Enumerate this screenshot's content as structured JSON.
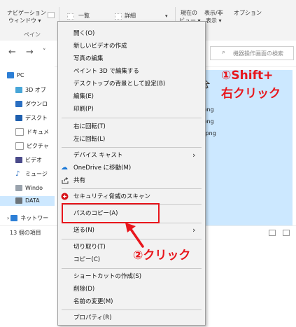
{
  "ribbon": {
    "nav_pane_label_1": "ナビゲーション",
    "nav_pane_label_2": "ウィンドウ ▾",
    "pane_group": "ペイン",
    "view_list": "一覧",
    "view_details": "詳細",
    "current_view_1": "現在の",
    "current_view_2": "ビュー ▾",
    "show_hide_1": "表示/非",
    "show_hide_2": "表示 ▾",
    "options": "オプション"
  },
  "search": {
    "placeholder": "機器操作画面の検索"
  },
  "nav_pane": {
    "items": [
      {
        "label": "PC"
      },
      {
        "label": "3D オブ"
      },
      {
        "label": "ダウンロ"
      },
      {
        "label": "デスクト"
      },
      {
        "label": "ドキュメ"
      },
      {
        "label": "ピクチャ"
      },
      {
        "label": "ビデオ"
      },
      {
        "label": "ミュージ"
      },
      {
        "label": "Windo"
      },
      {
        "label": "DATA"
      },
      {
        "label": "ネットワー"
      }
    ]
  },
  "files": [
    {
      "name": "e.png"
    },
    {
      "name": "e.png"
    },
    {
      "name": "te.png"
    }
  ],
  "status": {
    "item_count": "13 個の項目"
  },
  "context_menu": {
    "items": [
      {
        "label": "開く(O)"
      },
      {
        "label": "新しいビデオの作成"
      },
      {
        "label": "写真の編集"
      },
      {
        "label": "ペイント 3D で編集する"
      },
      {
        "label": "デスクトップの背景として設定(B)"
      },
      {
        "label": "編集(E)"
      },
      {
        "label": "印刷(P)"
      },
      {
        "label": "右に回転(T)"
      },
      {
        "label": "左に回転(L)"
      },
      {
        "label": "デバイス キャスト"
      },
      {
        "label": "OneDrive に移動(M)"
      },
      {
        "label": "共有"
      },
      {
        "label": "セキュリティ脅威のスキャン"
      },
      {
        "label": "パスのコピー(A)"
      },
      {
        "label": "送る(N)"
      },
      {
        "label": "切り取り(T)"
      },
      {
        "label": "コピー(C)"
      },
      {
        "label": "ショートカットの作成(S)"
      },
      {
        "label": "削除(D)"
      },
      {
        "label": "名前の変更(M)"
      },
      {
        "label": "プロパティ(R)"
      }
    ]
  },
  "annotations": {
    "step1_line1": "①Shift+",
    "step1_line2": "右クリック",
    "step2": "②クリック"
  },
  "colors": {
    "annotation_red": "#e8161c",
    "selection_blue": "#cce8ff",
    "menu_bg": "#f2f2f2"
  }
}
